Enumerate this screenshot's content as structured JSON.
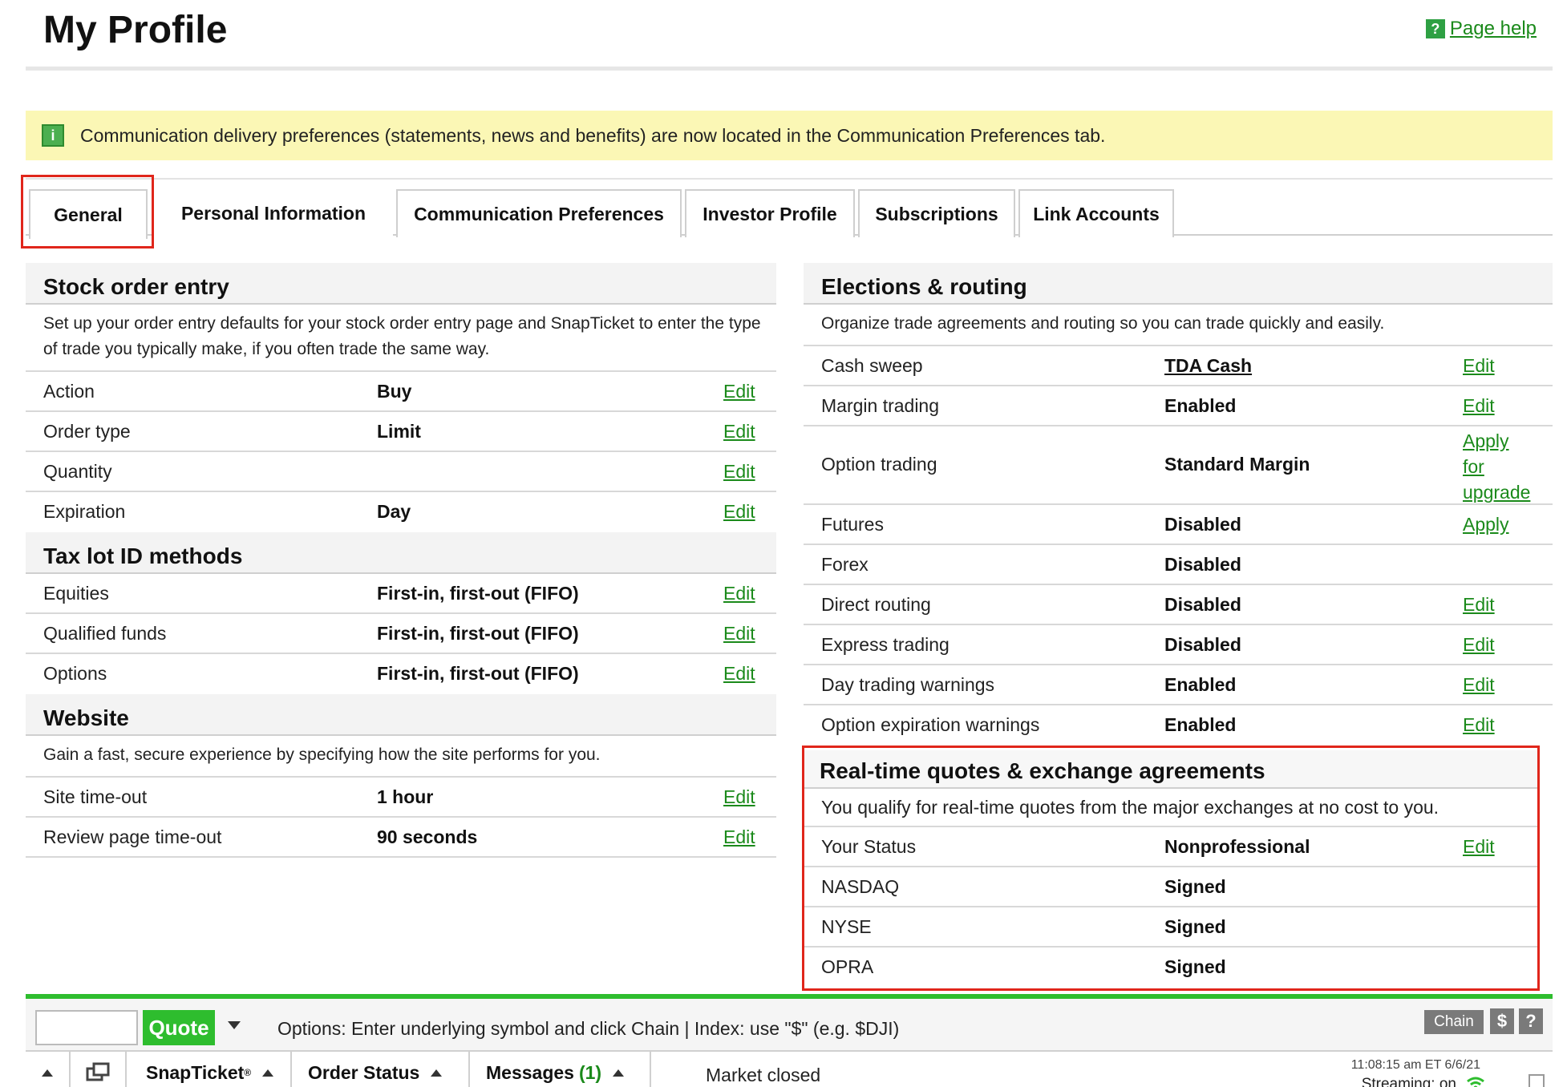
{
  "header": {
    "title": "My Profile",
    "help_link": "Page help",
    "help_icon": "question-icon"
  },
  "notice": {
    "icon": "info-icon",
    "text": "Communication delivery preferences (statements, news and benefits) are now located in the Communication Preferences tab."
  },
  "tabs": [
    {
      "label": "General",
      "active": true
    },
    {
      "label": "Personal Information"
    },
    {
      "label": "Communication Preferences"
    },
    {
      "label": "Investor Profile"
    },
    {
      "label": "Subscriptions"
    },
    {
      "label": "Link Accounts"
    }
  ],
  "stock_order_entry": {
    "title": "Stock order entry",
    "description": "Set up your order entry defaults for your stock order entry page and SnapTicket to enter the type of trade you typically make, if you often trade the same way.",
    "rows": [
      {
        "label": "Action",
        "value": "Buy",
        "action": "Edit"
      },
      {
        "label": "Order type",
        "value": "Limit",
        "action": "Edit"
      },
      {
        "label": "Quantity",
        "value": "",
        "action": "Edit"
      },
      {
        "label": "Expiration",
        "value": "Day",
        "action": "Edit"
      }
    ]
  },
  "tax_lot": {
    "title": "Tax lot ID methods",
    "rows": [
      {
        "label": "Equities",
        "value": "First-in, first-out (FIFO)",
        "action": "Edit"
      },
      {
        "label": "Qualified funds",
        "value": "First-in, first-out (FIFO)",
        "action": "Edit"
      },
      {
        "label": "Options",
        "value": "First-in, first-out (FIFO)",
        "action": "Edit"
      }
    ]
  },
  "website": {
    "title": "Website",
    "description": "Gain a fast, secure experience by specifying how the site performs for you.",
    "rows": [
      {
        "label": "Site time-out",
        "value": "1 hour",
        "action": "Edit"
      },
      {
        "label": "Review page time-out",
        "value": "90 seconds",
        "action": "Edit"
      }
    ]
  },
  "elections": {
    "title": "Elections & routing",
    "description": "Organize trade agreements and routing so you can trade quickly and easily.",
    "rows": [
      {
        "label": "Cash sweep",
        "value": "TDA Cash",
        "action": "Edit"
      },
      {
        "label": "Margin trading",
        "value": "Enabled",
        "action": "Edit"
      },
      {
        "label": "Option trading",
        "value": "Standard Margin",
        "action_lines": [
          "Apply",
          "for",
          "upgrade"
        ]
      },
      {
        "label": "Futures",
        "value": "Disabled",
        "action": "Apply"
      },
      {
        "label": "Forex",
        "value": "Disabled",
        "action": ""
      },
      {
        "label": "Direct routing",
        "value": "Disabled",
        "action": "Edit"
      },
      {
        "label": "Express trading",
        "value": "Disabled",
        "action": "Edit"
      },
      {
        "label": "Day trading warnings",
        "value": "Enabled",
        "action": "Edit"
      },
      {
        "label": "Option expiration warnings",
        "value": "Enabled",
        "action": "Edit"
      }
    ]
  },
  "realtime": {
    "title": "Real-time quotes & exchange agreements",
    "description": "You qualify for real-time quotes from the major exchanges at no cost to you.",
    "rows": [
      {
        "label": "Your Status",
        "value": "Nonprofessional",
        "action": "Edit"
      },
      {
        "label": "NASDAQ",
        "value": "Signed",
        "action": ""
      },
      {
        "label": "NYSE",
        "value": "Signed",
        "action": ""
      },
      {
        "label": "OPRA",
        "value": "Signed",
        "action": ""
      }
    ]
  },
  "bottom_bar": {
    "quote_button": "Quote",
    "options_hint": "Options: Enter underlying symbol and click Chain | Index: use \"$\" (e.g. $DJI)",
    "chain_button": "Chain",
    "dollar_button": "$",
    "help_button": "?",
    "snapticket": "SnapTicket",
    "snapticket_mark": "®",
    "order_status": "Order Status",
    "messages": "Messages",
    "messages_count": "(1)",
    "market_status": "Market closed",
    "timestamp": "11:08:15 am ET 6/6/21",
    "streaming": "Streaming: on"
  },
  "colors": {
    "accent_green": "#1b8a1b",
    "quote_green": "#2ebd2e",
    "notice_yellow": "#fbf7b5",
    "highlight_red": "#e0261b"
  }
}
